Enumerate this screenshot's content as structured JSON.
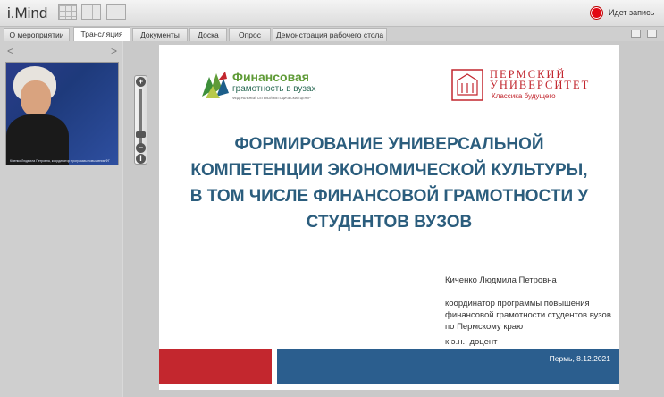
{
  "app": {
    "title": "i.Mind"
  },
  "recording": {
    "label": "Идет запись",
    "color": "#e30613"
  },
  "tabs": [
    {
      "label": "О мероприятии",
      "active": false
    },
    {
      "label": "Трансляция",
      "active": true
    },
    {
      "label": "Документы",
      "active": false
    },
    {
      "label": "Доска",
      "active": false
    },
    {
      "label": "Опрос",
      "active": false
    },
    {
      "label": "Демонстрация рабочего стола",
      "active": false
    }
  ],
  "video": {
    "nav_prev": "<",
    "nav_next": ">",
    "caption": "Кіченко Людмила Петровна, координатор программы повышения ФГ"
  },
  "zoom": {
    "plus": "+",
    "minus": "−",
    "info": "i",
    "level": 0.82
  },
  "slide": {
    "logo_left": {
      "line1": "Финансовая",
      "line2": "грамотность в вузах",
      "line3": "ФЕДЕРАЛЬНЫЙ СЕТЕВОЙ МЕТОДИЧЕСКИЙ ЦЕНТР"
    },
    "logo_right": {
      "line1": "ПЕРМСКИЙ",
      "line2": "УНИВЕРСИТЕТ",
      "line3": "Классика будущего"
    },
    "title": "ФОРМИРОВАНИЕ УНИВЕРСАЛЬНОЙ КОМПЕТЕНЦИИ ЭКОНОМИЧЕСКОЙ КУЛЬТУРЫ, В ТОМ ЧИСЛЕ ФИНАНСОВОЙ ГРАМОТНОСТИ У СТУДЕНТОВ ВУЗОВ",
    "speaker": "Киченко Людмила Петровна",
    "role": "координатор программы повышения финансовой грамотности студентов вузов по Пермскому краю",
    "degree": "к.э.н., доцент",
    "date": "Пермь, 8.12.2021",
    "colors": {
      "title": "#2b5d7d",
      "red_bar": "#c3272e",
      "blue_bar": "#2b5e8e"
    }
  }
}
